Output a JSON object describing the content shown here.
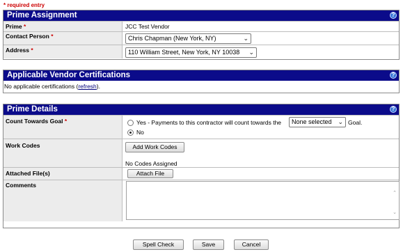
{
  "required_note": "* required entry",
  "prime_assignment": {
    "title": "Prime Assignment",
    "help": "?",
    "prime_label": "Prime",
    "prime_value": "JCC Test Vendor",
    "contact_label": "Contact Person",
    "contact_value": "Chris Chapman (New York, NY)",
    "address_label": "Address",
    "address_value": "110 William Street, New York, NY 10038"
  },
  "certifications": {
    "title": "Applicable Vendor Certifications",
    "help": "?",
    "text_before": "No applicable certifications (",
    "link": "refresh",
    "text_after": ")."
  },
  "prime_details": {
    "title": "Prime Details",
    "help": "?",
    "goal_label": "Count Towards Goal",
    "yes_text": "Yes - Payments to this contractor will count towards the",
    "goal_select": "None selected",
    "goal_suffix": "Goal.",
    "no_text": "No",
    "selected": "No",
    "work_codes_label": "Work Codes",
    "add_work_codes": "Add Work Codes",
    "no_codes": "No Codes Assigned",
    "files_label": "Attached File(s)",
    "attach_file": "Attach File",
    "comments_label": "Comments",
    "comments_value": ""
  },
  "actions": {
    "spell_check": "Spell Check",
    "save": "Save",
    "cancel": "Cancel"
  },
  "icons": {
    "required_marker": "*",
    "dropdown": "chevron-down-icon",
    "help": "help-icon"
  }
}
